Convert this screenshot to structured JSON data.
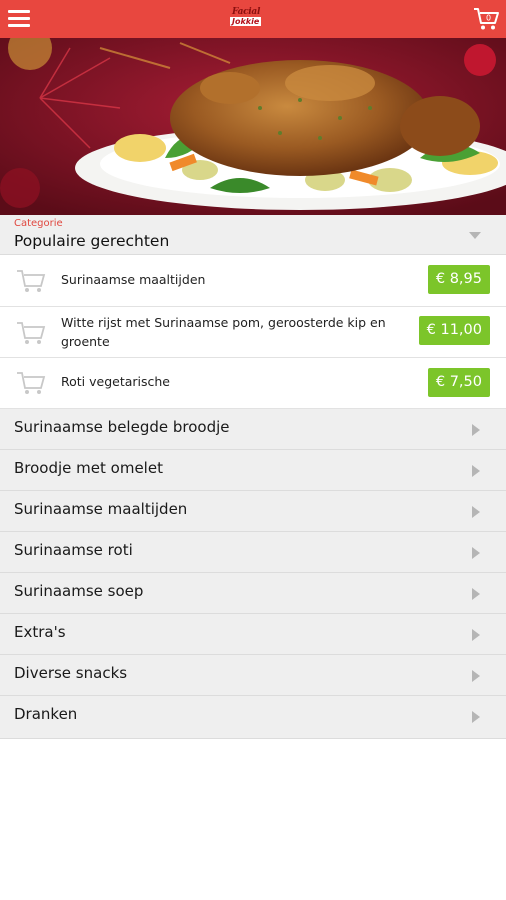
{
  "header": {
    "logo_line1": "Facial",
    "logo_line2": "Jokkie",
    "menu_icon": "hamburger-icon",
    "cart_icon": "cart-icon",
    "cart_count": "0",
    "brand_color": "#e8473f"
  },
  "hero": {
    "description_icon": "roast-chicken-image"
  },
  "category": {
    "caption": "Categorie",
    "title": "Populaire gerechten"
  },
  "items": [
    {
      "name": "Surinaamse maaltijden",
      "price": "€ 8,95"
    },
    {
      "name": "Witte rijst met Surinaamse pom, geroosterde kip en groente",
      "price": "€ 11,00"
    },
    {
      "name": "Roti vegetarische",
      "price": "€ 7,50"
    }
  ],
  "categories": [
    "Surinaamse belegde broodje",
    "Broodje met omelet",
    "Surinaamse maaltijden",
    "Surinaamse roti",
    "Surinaamse soep",
    "Extra's",
    "Diverse snacks",
    "Dranken"
  ],
  "colors": {
    "price_badge": "#7cc52a",
    "caption": "#e0473f"
  }
}
